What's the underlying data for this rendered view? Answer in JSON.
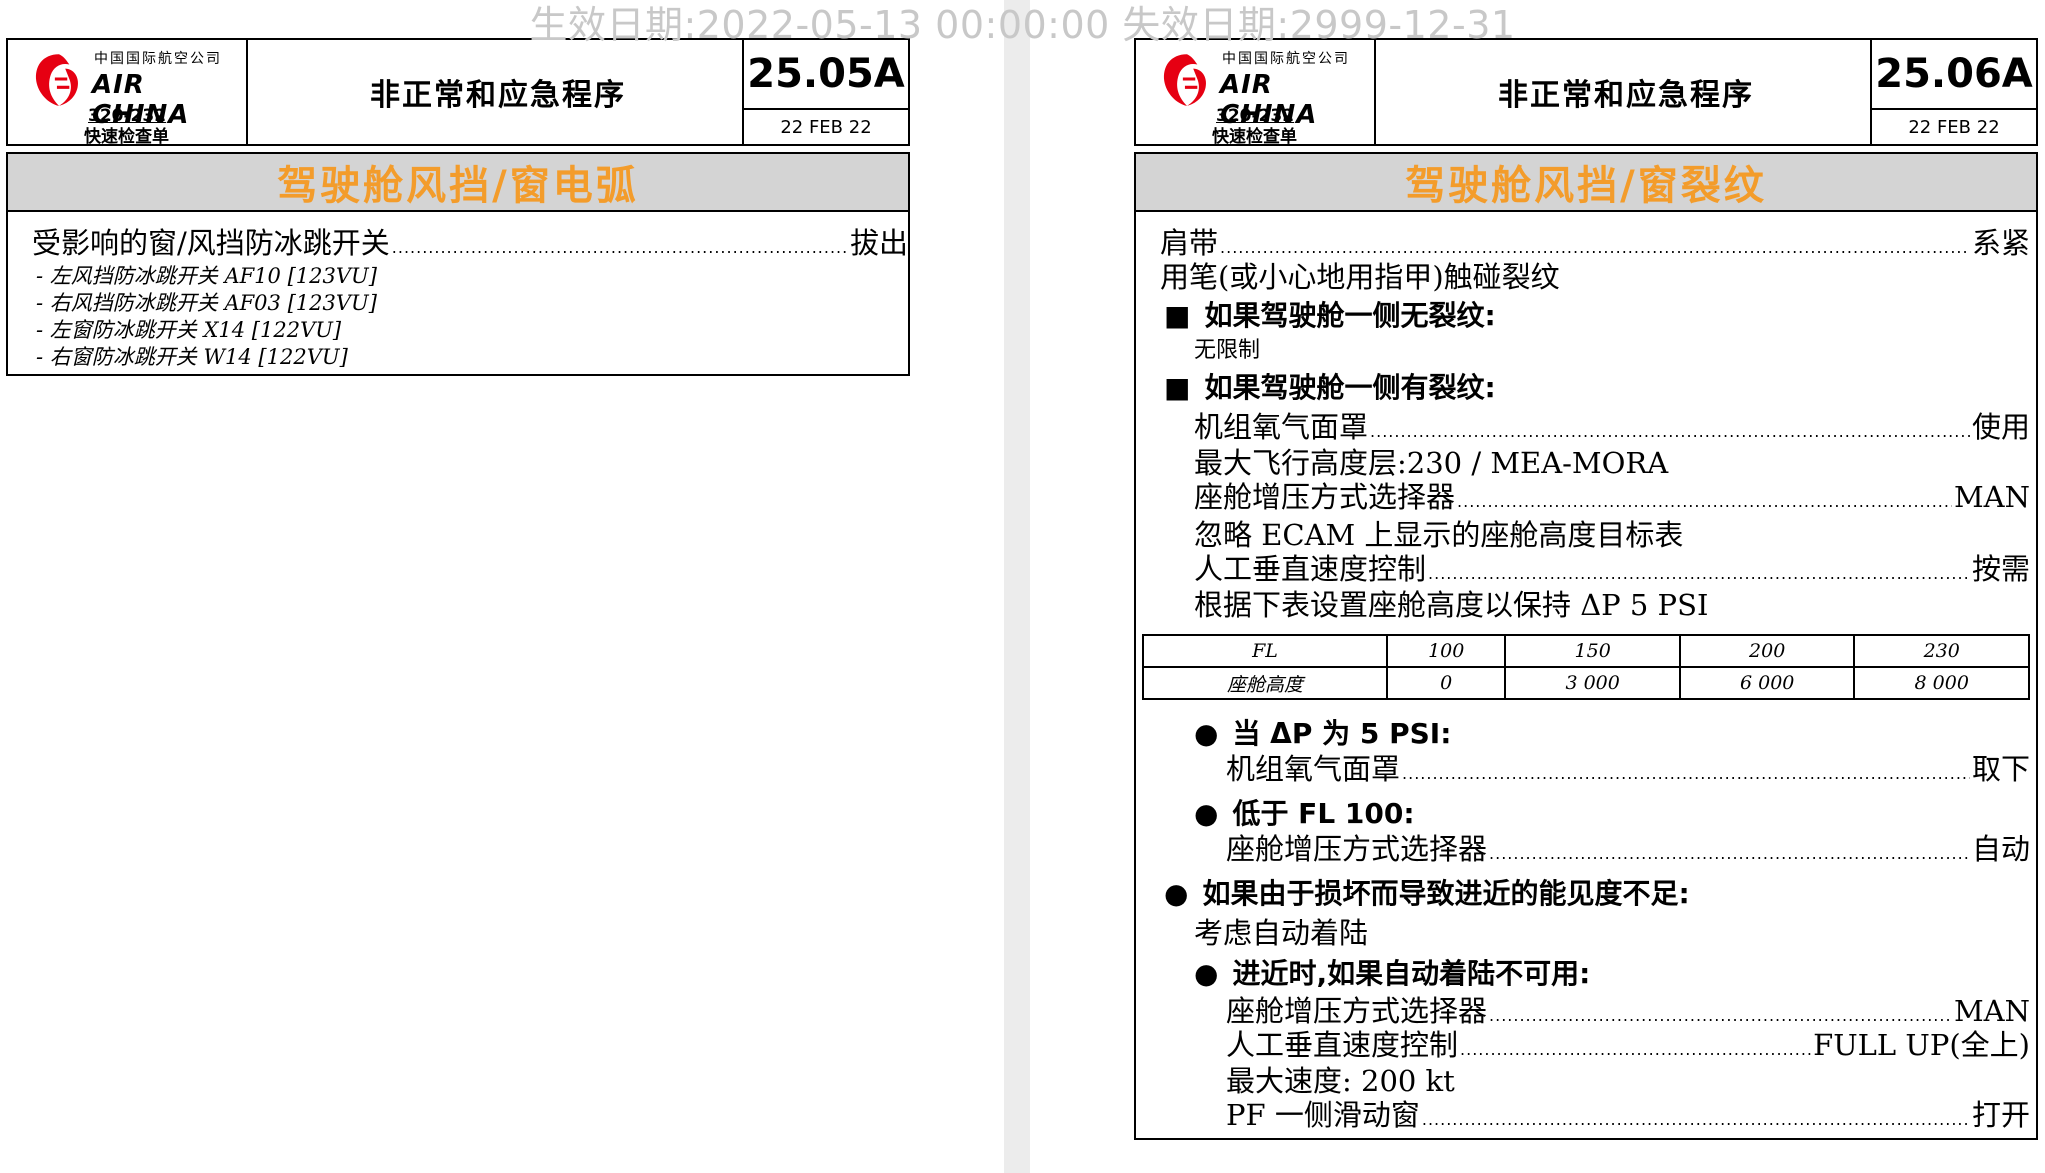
{
  "watermark": "生效日期:2022-05-13 00:00:00 失效日期:2999-12-31",
  "brand": {
    "cn": "中国国际航空公司",
    "en": "AIR CHINA",
    "model": "320-232",
    "checklist": "快速检查单",
    "brand_color": "#e60012"
  },
  "left": {
    "header_title": "非正常和应急程序",
    "code": "25.05A",
    "date": "22 FEB 22",
    "proc_title": "驾驶舱风挡/窗电弧",
    "step": {
      "label": "受影响的窗/风挡防冰跳开关",
      "value": "拔出"
    },
    "items": [
      "-  左风挡防冰跳开关 AF10 [123VU]",
      "-  右风挡防冰跳开关 AF03 [123VU]",
      "-  左窗防冰跳开关 X14 [122VU]",
      "-  右窗防冰跳开关 W14 [122VU]"
    ]
  },
  "right": {
    "header_title": "非正常和应急程序",
    "code": "25.06A",
    "date": "22 FEB 22",
    "proc_title": "驾驶舱风挡/窗裂纹",
    "s1": {
      "label": "肩带",
      "value": "系紧"
    },
    "s2": "用笔(或小心地用指甲)触碰裂纹",
    "h1": "如果驾驶舱一侧无裂纹:",
    "h1_body": "无限制",
    "h2": "如果驾驶舱一侧有裂纹:",
    "s3": {
      "label": "机组氧气面罩",
      "value": "使用"
    },
    "s4": "最大飞行高度层:230 / MEA-MORA",
    "s5": {
      "label": "座舱增压方式选择器",
      "value": "MAN"
    },
    "s6": "忽略 ECAM 上显示的座舱高度目标表",
    "s7": {
      "label": "人工垂直速度控制",
      "value": "按需"
    },
    "s8": "根据下表设置座舱高度以保持 ΔP 5 PSI",
    "table": {
      "row1": [
        "FL",
        "100",
        "150",
        "200",
        "230"
      ],
      "row2": [
        "座舱高度",
        "0",
        "3 000",
        "6 000",
        "8 000"
      ]
    },
    "b1": "当 ΔP 为 5 PSI:",
    "s9": {
      "label": "机组氧气面罩",
      "value": "取下"
    },
    "b2": "低于 FL 100:",
    "s10": {
      "label": "座舱增压方式选择器",
      "value": "自动"
    },
    "b3": "如果由于损坏而导致进近的能见度不足:",
    "s11": "考虑自动着陆",
    "b4": "进近时,如果自动着陆不可用:",
    "s12": {
      "label": "座舱增压方式选择器",
      "value": "MAN"
    },
    "s13": {
      "label": "人工垂直速度控制",
      "value": "FULL UP(全上)"
    },
    "s14": "最大速度: 200 kt",
    "s15": {
      "label": "PF 一侧滑动窗",
      "value": "打开"
    }
  }
}
